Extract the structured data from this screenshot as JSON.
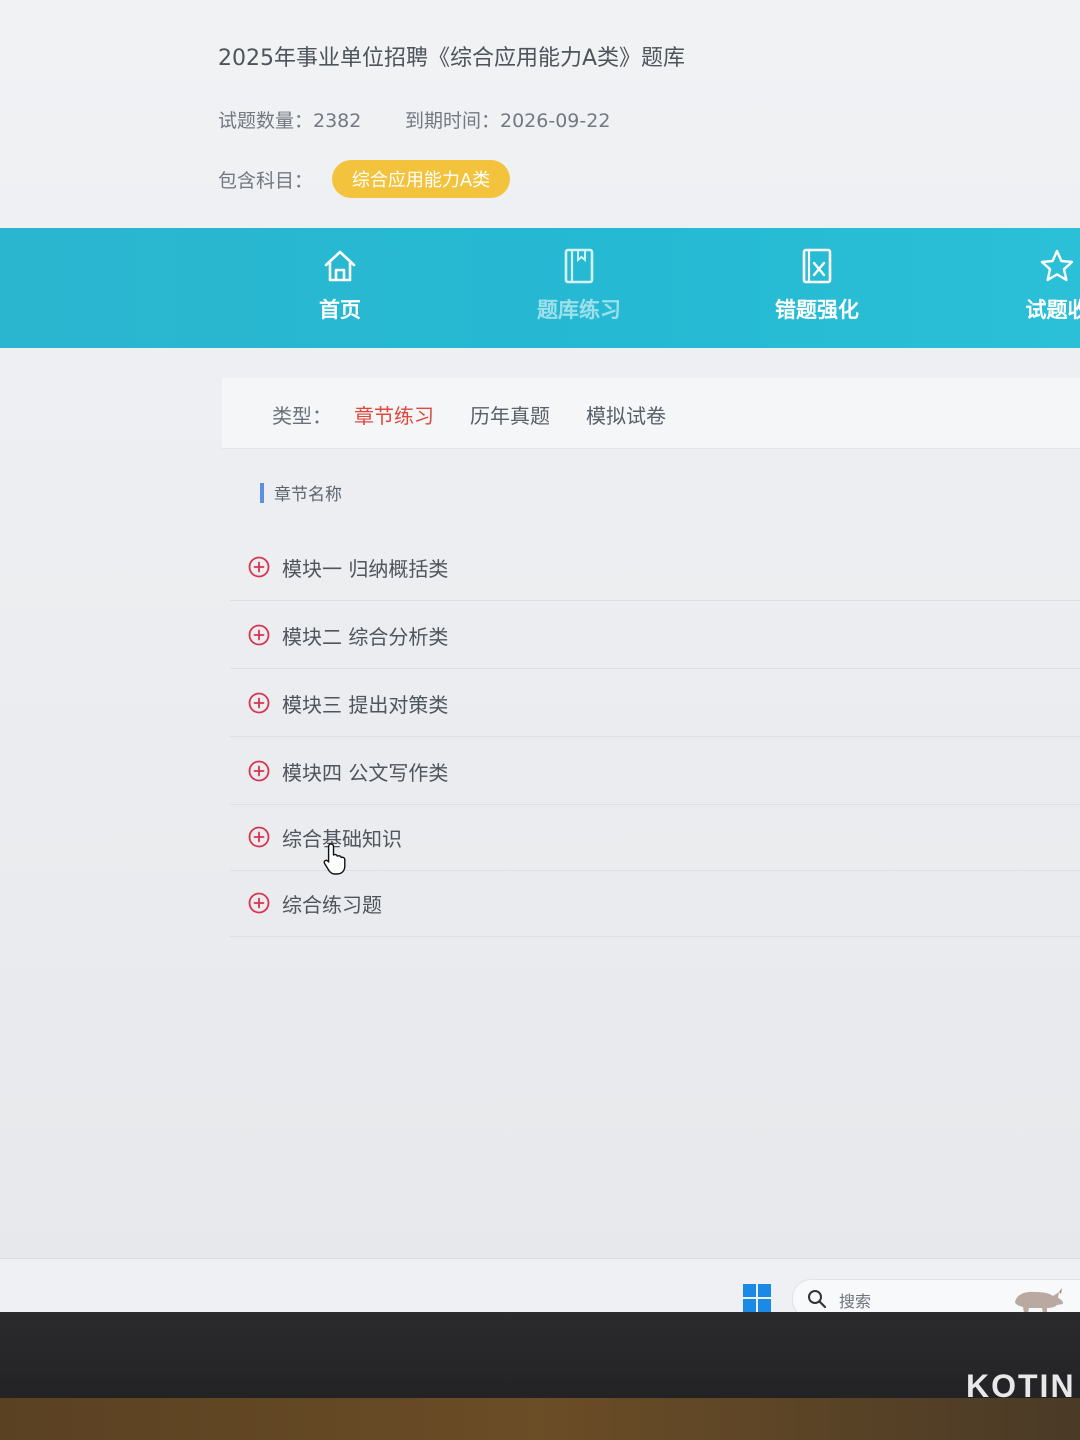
{
  "header": {
    "title": "2025年事业单位招聘《综合应用能力A类》题库",
    "question_count": "试题数量：2382",
    "expire_date": "到期时间：2026-09-22",
    "subject_label": "包含科目：",
    "subject_badge": "综合应用能力A类"
  },
  "nav": {
    "items": [
      {
        "label": "首页",
        "icon": "home-icon"
      },
      {
        "label": "题库练习",
        "icon": "book-icon",
        "active": true
      },
      {
        "label": "错题强化",
        "icon": "wrong-question-icon"
      },
      {
        "label": "试题收",
        "icon": "star-icon"
      }
    ]
  },
  "type_filter": {
    "label": "类型：",
    "tabs": [
      "章节练习",
      "历年真题",
      "模拟试卷"
    ],
    "active": "章节练习"
  },
  "chapters": {
    "section_title": "章节名称",
    "items": [
      "模块一 归纳概括类",
      "模块二 综合分析类",
      "模块三 提出对策类",
      "模块四 公文写作类",
      "综合基础知识",
      "综合练习题"
    ]
  },
  "taskbar": {
    "search_placeholder": "搜索"
  },
  "monitor": {
    "brand": "KOTIN"
  },
  "colors": {
    "accent": "#25b9d3",
    "badge": "#f3c33e",
    "active_tab": "#e1473e",
    "chapter_icon": "#d9334f"
  }
}
